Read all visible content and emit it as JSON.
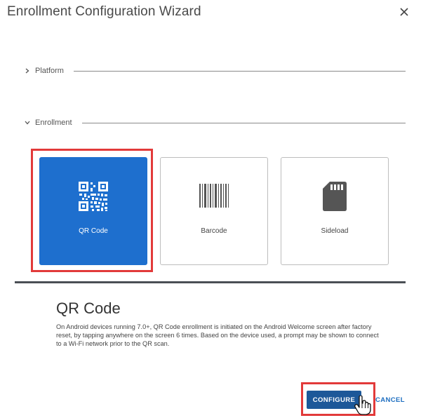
{
  "dialog": {
    "title": "Enrollment Configuration Wizard",
    "close_icon": "close-icon"
  },
  "sections": {
    "platform": {
      "label": "Platform",
      "expanded": false
    },
    "enrollment": {
      "label": "Enrollment",
      "expanded": true
    }
  },
  "options": [
    {
      "label": "QR Code",
      "icon": "qr-code-icon",
      "selected": true
    },
    {
      "label": "Barcode",
      "icon": "barcode-icon",
      "selected": false
    },
    {
      "label": "Sideload",
      "icon": "sd-card-icon",
      "selected": false
    }
  ],
  "description": {
    "title": "QR Code",
    "text": "On Android devices running 7.0+, QR Code enrollment is initiated on the Android Welcome screen after factory reset, by tapping anywhere on the screen 6 times. Based on the device used, a prompt may be shown to connect to a Wi-Fi network prior to the QR scan."
  },
  "footer": {
    "configure_label": "CONFIGURE",
    "cancel_label": "CANCEL"
  },
  "colors": {
    "accent": "#1e6fce",
    "primary_button": "#1d5899",
    "highlight": "#e23a3a"
  }
}
